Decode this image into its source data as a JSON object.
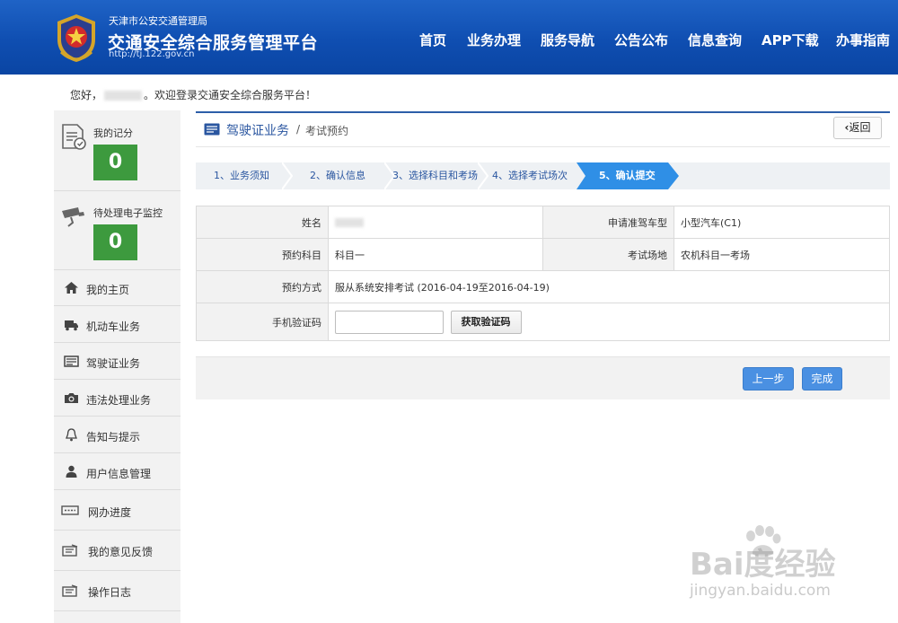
{
  "header": {
    "agency": "天津市公安交通管理局",
    "title": "交通安全综合服务管理平台",
    "url": "http://tj.122.gov.cn",
    "nav": [
      "首页",
      "业务办理",
      "服务导航",
      "公告公布",
      "信息查询",
      "APP下载",
      "办事指南"
    ]
  },
  "greeting": {
    "prefix": "您好，",
    "suffix": "。欢迎登录交通安全综合服务平台！"
  },
  "sidebar": {
    "score": {
      "label": "我的记分",
      "value": "0"
    },
    "monitor": {
      "label": "待处理电子监控",
      "value": "0"
    },
    "items": [
      {
        "label": "我的主页",
        "icon": "home-icon"
      },
      {
        "label": "机动车业务",
        "icon": "truck-icon"
      },
      {
        "label": "驾驶证业务",
        "icon": "license-card-icon"
      },
      {
        "label": "违法处理业务",
        "icon": "camera-icon"
      },
      {
        "label": "告知与提示",
        "icon": "bell-icon"
      },
      {
        "label": "用户信息管理",
        "icon": "user-icon"
      },
      {
        "label": "网办进度",
        "icon": "progress-icon"
      },
      {
        "label": "我的意见反馈",
        "icon": "feedback-icon"
      },
      {
        "label": "操作日志",
        "icon": "log-icon"
      }
    ]
  },
  "breadcrumb": {
    "main": "驾驶证业务",
    "separator": "/",
    "sub": "考试预约",
    "back": "返回"
  },
  "steps": [
    "1、业务须知",
    "2、确认信息",
    "3、选择科目和考场",
    "4、选择考试场次",
    "5、确认提交"
  ],
  "form": {
    "name_label": "姓名",
    "vehicle_label": "申请准驾车型",
    "vehicle_value": "小型汽车(C1)",
    "subject_label": "预约科目",
    "subject_value": "科目一",
    "site_label": "考试场地",
    "site_value": "农机科目一考场",
    "method_label": "预约方式",
    "method_value": "服从系统安排考试 (2016-04-19至2016-04-19)",
    "sms_label": "手机验证码",
    "sms_value": "",
    "sms_button": "获取验证码"
  },
  "actions": {
    "prev": "上一步",
    "finish": "完成"
  },
  "watermark": {
    "logo": "Bai度经验",
    "url": "jingyan.baidu.com"
  },
  "colors": {
    "header": "#0f4eb1",
    "accent": "#4a90e2",
    "count_bg": "#3d9a3e",
    "active_step": "#2f8fe6"
  }
}
